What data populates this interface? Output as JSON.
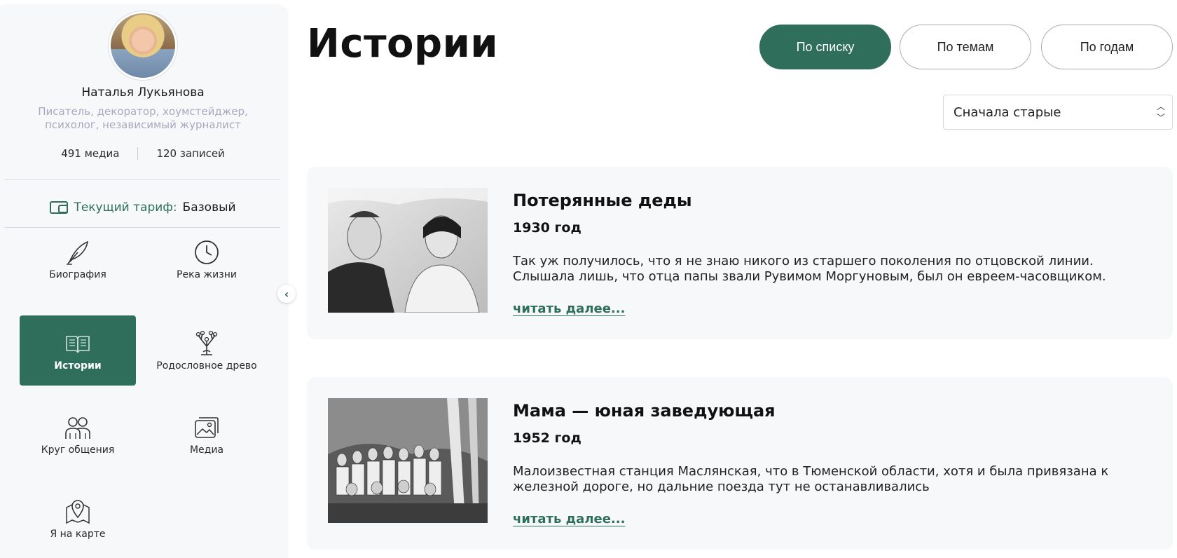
{
  "profile": {
    "name": "Наталья Лукьянова",
    "description": "Писатель, декоратор, хоумстейджер, психолог, независимый журналист",
    "media_count": "491 медиа",
    "records_count": "120 записей"
  },
  "tariff": {
    "label": "Текущий тариф:",
    "value": "Базовый"
  },
  "nav": {
    "biography": "Биография",
    "river": "Река жизни",
    "stories": "Истории",
    "tree": "Родословное древо",
    "circle": "Круг общения",
    "media": "Медиа",
    "map": "Я на карте"
  },
  "main": {
    "title": "Истории",
    "view_list": "По списку",
    "view_topics": "По темам",
    "view_years": "По годам",
    "sort_value": "Сначала старые"
  },
  "stories": [
    {
      "title": "Потерянные деды",
      "year": "1930 год",
      "excerpt": "Так уж получилось, что я не знаю никого из старшего поколения по отцовской линии. Слышала лишь, что отца папы звали Рувимом Моргуновым, был он евреем-часовщиком.",
      "more": "читать далее..."
    },
    {
      "title": "Мама — юная заведующая",
      "year": "1952 год",
      "excerpt": "Малоизвестная станция Маслянская, что в Тюменской области, хотя и была привязана к железной дороге, но дальние поезда тут не останавливались",
      "more": "читать далее..."
    }
  ],
  "colors": {
    "accent": "#2e6e5a",
    "muted_text": "#a8a8bf"
  }
}
